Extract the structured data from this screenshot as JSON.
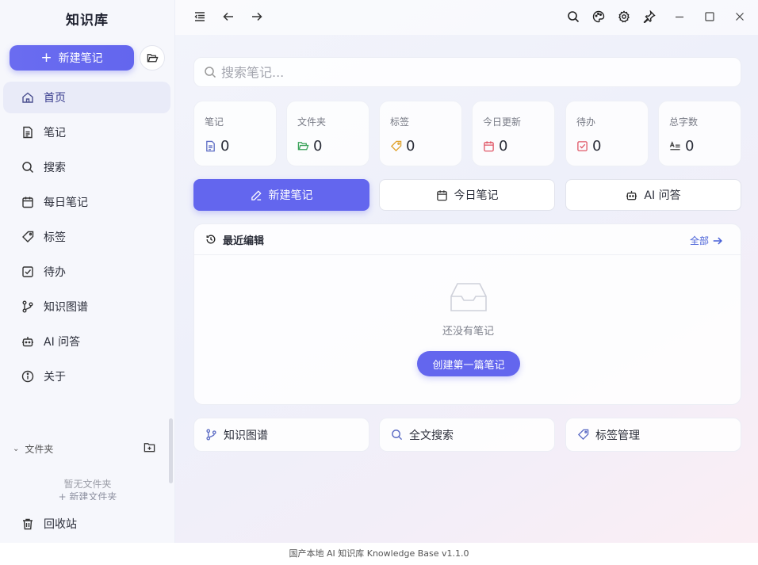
{
  "sidebar": {
    "brand": "知识库",
    "new_note_label": "新建笔记",
    "items": [
      {
        "label": "首页",
        "icon": "home-icon"
      },
      {
        "label": "笔记",
        "icon": "document-icon"
      },
      {
        "label": "搜索",
        "icon": "search-icon"
      },
      {
        "label": "每日笔记",
        "icon": "calendar-icon"
      },
      {
        "label": "标签",
        "icon": "tag-icon"
      },
      {
        "label": "待办",
        "icon": "checkbox-icon"
      },
      {
        "label": "知识图谱",
        "icon": "graph-icon"
      },
      {
        "label": "AI 问答",
        "icon": "robot-icon"
      },
      {
        "label": "关于",
        "icon": "info-icon"
      }
    ],
    "folders_title": "文件夹",
    "folders_empty": "暂无文件夹",
    "folders_create": "+ 新建文件夹",
    "trash_label": "回收站"
  },
  "search": {
    "placeholder": "搜索笔记..."
  },
  "stats": [
    {
      "label": "笔记",
      "value": "0",
      "icon": "document-icon",
      "color": "#5b6bc4"
    },
    {
      "label": "文件夹",
      "value": "0",
      "icon": "folder-icon",
      "color": "#3aa35a"
    },
    {
      "label": "标签",
      "value": "0",
      "icon": "tag-icon",
      "color": "#e0a12a"
    },
    {
      "label": "今日更新",
      "value": "0",
      "icon": "calendar-icon",
      "color": "#e05666"
    },
    {
      "label": "待办",
      "value": "0",
      "icon": "checkbox-icon",
      "color": "#e05666"
    },
    {
      "label": "总字数",
      "value": "0",
      "icon": "text-count-icon",
      "color": "#444"
    }
  ],
  "actions": {
    "new_note": "新建笔记",
    "today_note": "今日笔记",
    "ai_qa": "AI 问答"
  },
  "recent": {
    "title": "最近编辑",
    "all_label": "全部",
    "empty_text": "还没有笔记",
    "create_first": "创建第一篇笔记"
  },
  "quick_links": [
    {
      "label": "知识图谱",
      "icon": "graph-icon"
    },
    {
      "label": "全文搜索",
      "icon": "search-icon"
    },
    {
      "label": "标签管理",
      "icon": "tag-icon"
    }
  ],
  "footer": "国产本地 AI 知识库 Knowledge Base v1.1.0",
  "colors": {
    "accent": "#6366ee",
    "link": "#4a62d8"
  }
}
